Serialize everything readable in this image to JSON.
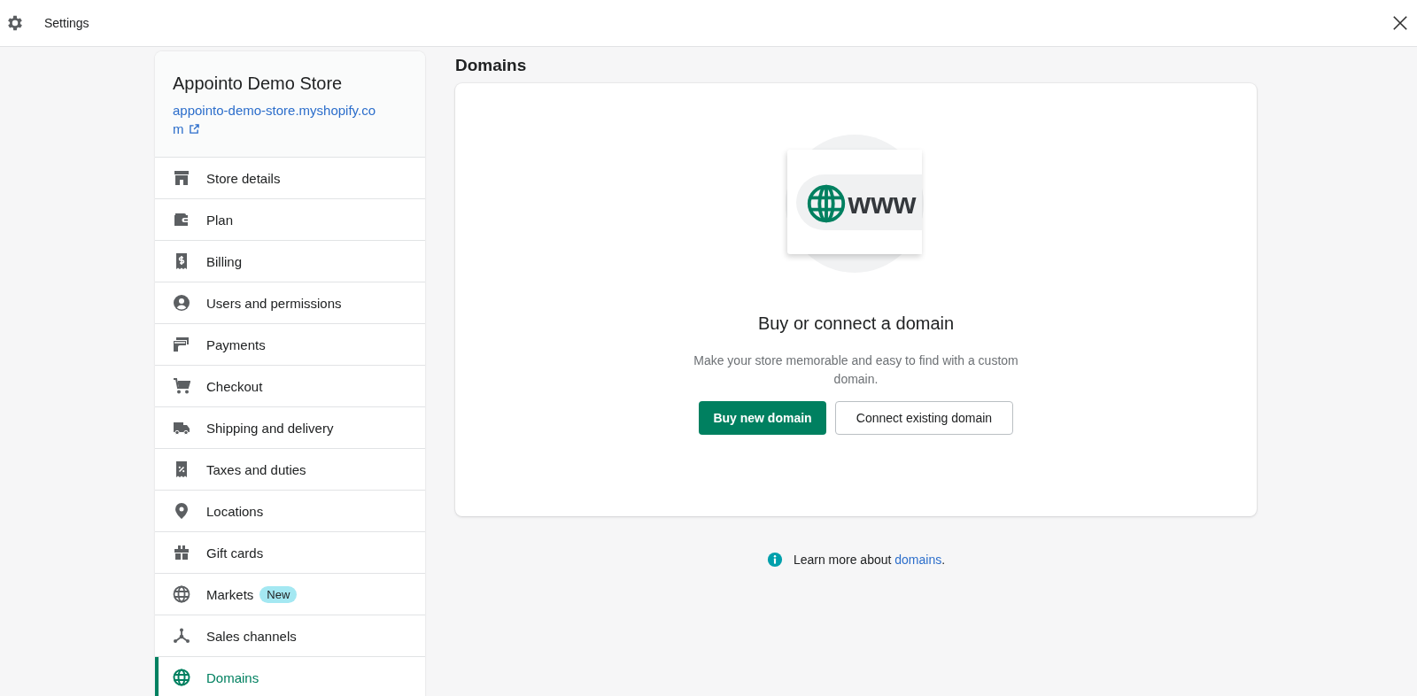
{
  "top_bar": {
    "title": "Settings"
  },
  "store": {
    "name": "Appointo Demo Store",
    "url": "appointo-demo-store.myshopify.com"
  },
  "sidebar": {
    "items": [
      {
        "label": "Store details",
        "selected": false
      },
      {
        "label": "Plan",
        "selected": false
      },
      {
        "label": "Billing",
        "selected": false
      },
      {
        "label": "Users and permissions",
        "selected": false
      },
      {
        "label": "Payments",
        "selected": false
      },
      {
        "label": "Checkout",
        "selected": false
      },
      {
        "label": "Shipping and delivery",
        "selected": false
      },
      {
        "label": "Taxes and duties",
        "selected": false
      },
      {
        "label": "Locations",
        "selected": false
      },
      {
        "label": "Gift cards",
        "selected": false
      },
      {
        "label": "Markets",
        "selected": false,
        "badge": "New"
      },
      {
        "label": "Sales channels",
        "selected": false
      },
      {
        "label": "Domains",
        "selected": true
      }
    ]
  },
  "page": {
    "title": "Domains",
    "empty_state": {
      "illustration_text": "www",
      "heading": "Buy or connect a domain",
      "description": "Make your store memorable and easy to find with a custom domain.",
      "buttons": [
        {
          "label": "Buy new domain",
          "kind": "primary"
        },
        {
          "label": "Connect existing domain",
          "kind": "secondary"
        }
      ]
    },
    "footer": {
      "text": "Learn more about ",
      "link": "domains",
      "after": "."
    }
  }
}
